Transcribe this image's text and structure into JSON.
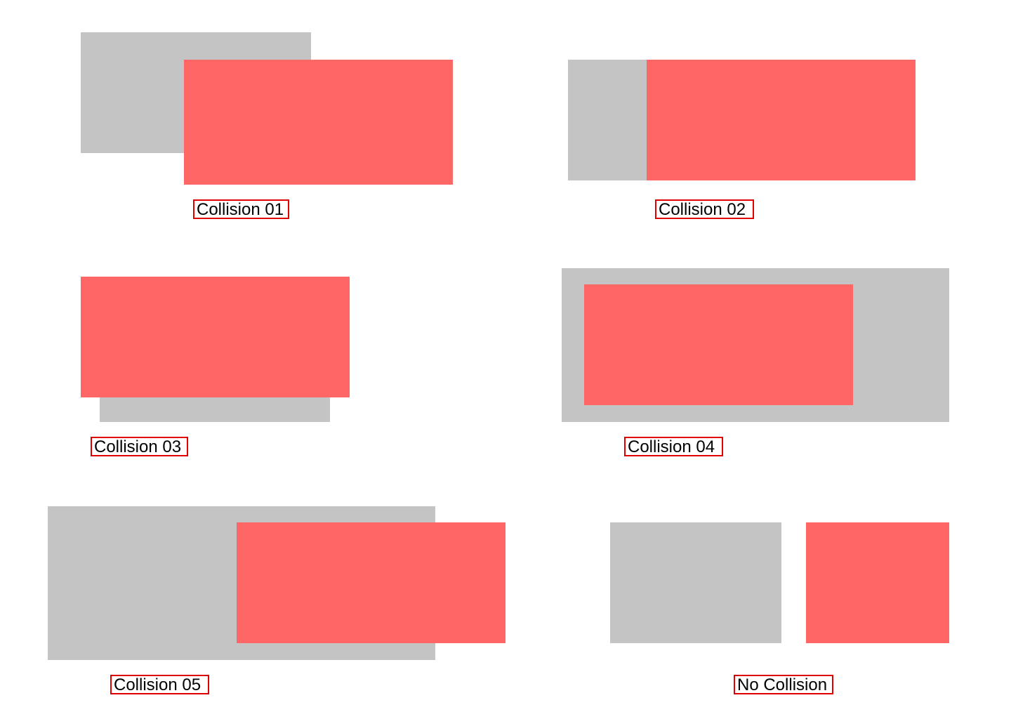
{
  "colors": {
    "background": "#ffffff",
    "gray_box": "#c4c4c4",
    "red_box": "#ff6666",
    "label_border": "#e00000",
    "label_text": "#000000"
  },
  "examples": [
    {
      "label": "Collision 01"
    },
    {
      "label": "Collision 02"
    },
    {
      "label": "Collision 03"
    },
    {
      "label": "Collision 04"
    },
    {
      "label": "Collision 05"
    },
    {
      "label": "No Collision"
    }
  ]
}
